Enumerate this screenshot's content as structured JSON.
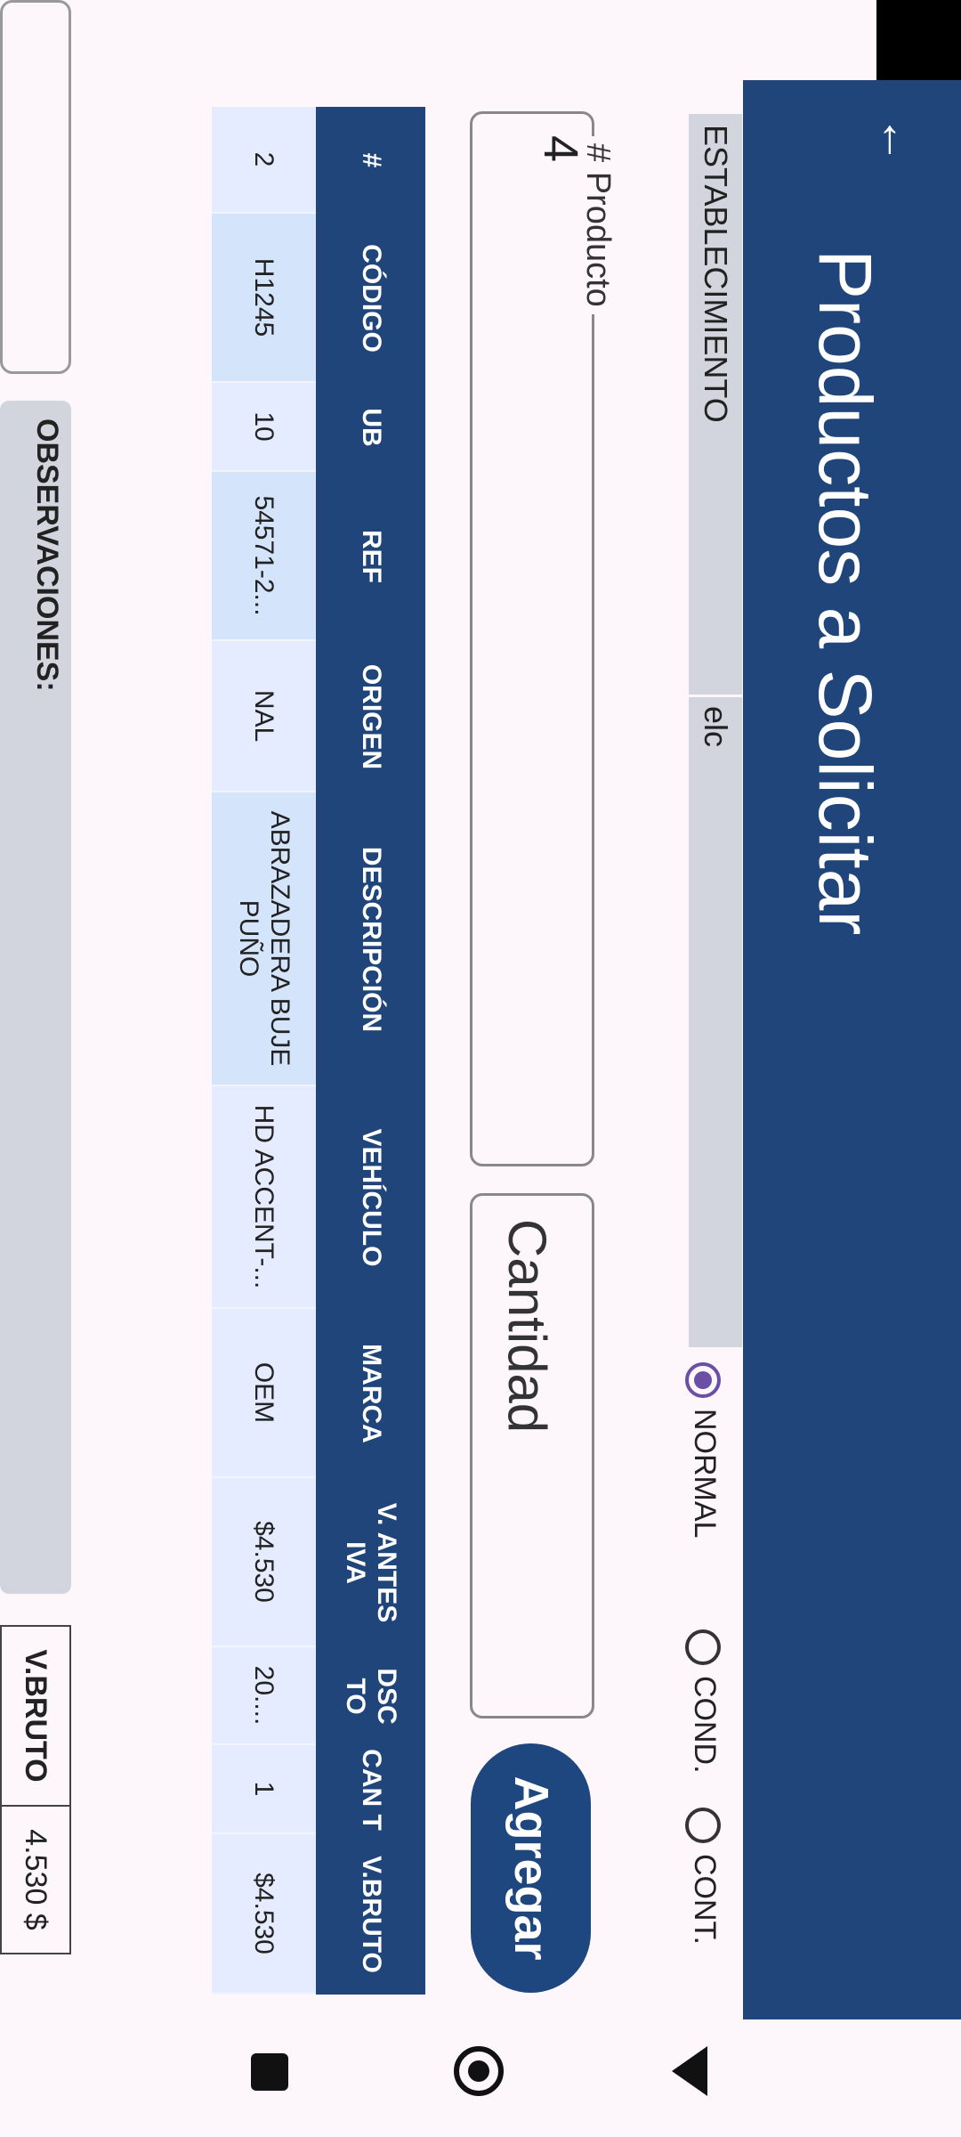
{
  "app": {
    "title": "Productos a Solicitar"
  },
  "establecimiento": {
    "label": "ESTABLECIMIENTO",
    "value": "elc"
  },
  "radios": [
    {
      "label": "NORMAL",
      "selected": true
    },
    {
      "label": "COND.",
      "selected": false
    },
    {
      "label": "CONT.",
      "selected": false
    }
  ],
  "form": {
    "producto_label": "# Producto",
    "producto_value": "4",
    "cantidad_placeholder": "Cantidad",
    "agregar_label": "Agregar"
  },
  "table": {
    "headers": [
      "#",
      "CÓDIGO",
      "UB",
      "REF",
      "ORIGEN",
      "DESCRIPCIÓN",
      "VEHÍCULO",
      "MARCA",
      "V. ANTES IVA",
      "DSC TO",
      "CAN T",
      "V.BRUTO"
    ],
    "rows": [
      [
        "2",
        "H1245",
        "10",
        "54571-2...",
        "NAL",
        "ABRAZADERA BUJE PUÑO",
        "HD ACCENT-...",
        "OEM",
        "$4.530",
        "20....",
        "1",
        "$4.530"
      ]
    ]
  },
  "footer": {
    "observaciones_label": "OBSERVACIONES:",
    "vbruto_label": "V.BRUTO",
    "vbruto_value": "4.530 $"
  },
  "navbar": {
    "icons": [
      "square-recent-icon",
      "home-circle-icon",
      "back-triangle-icon"
    ]
  }
}
